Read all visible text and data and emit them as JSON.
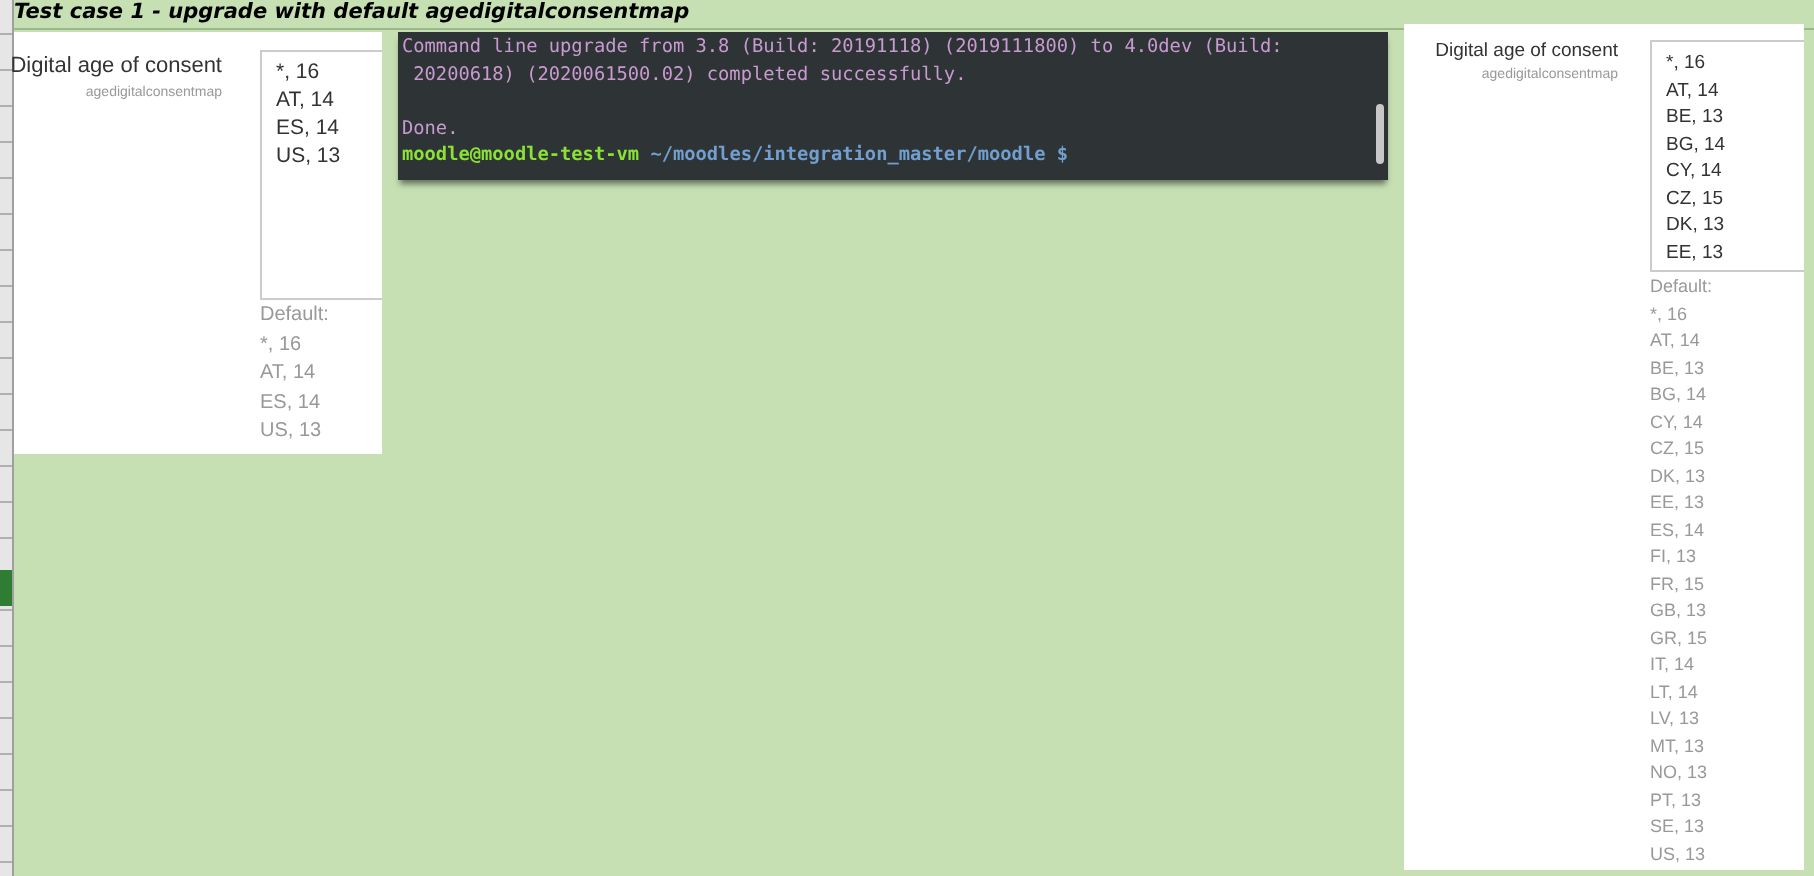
{
  "heading": "Test case 1 - upgrade with default agedigitalconsentmap",
  "left_panel": {
    "label": "Digital age of consent",
    "setting_name": "agedigitalconsentmap",
    "list_items": [
      "*, 16",
      "AT, 14",
      "ES, 14",
      "US, 13"
    ],
    "default_label": "Default:",
    "default_items": [
      "*, 16",
      "AT, 14",
      "ES, 14",
      "US, 13"
    ]
  },
  "terminal": {
    "output_blocks": [
      [
        "Command line upgrade from 3.8 (Build: 20191118) (2019111800) to 4.0dev (Build:",
        " 20200618) (2020061500.02) completed successfully."
      ],
      [
        "Done."
      ]
    ],
    "prompt": {
      "user_host": "moodle@moodle-test-vm",
      "path": "~/moodles/integration_master/moodle $"
    }
  },
  "right_panel": {
    "label": "Digital age of consent",
    "setting_name": "agedigitalconsentmap",
    "list_items": [
      "*, 16",
      "AT, 14",
      "BE, 13",
      "BG, 14",
      "CY, 14",
      "CZ, 15",
      "DK, 13",
      "EE, 13"
    ],
    "default_label": "Default:",
    "default_items": [
      "*, 16",
      "AT, 14",
      "BE, 13",
      "BG, 14",
      "CY, 14",
      "CZ, 15",
      "DK, 13",
      "EE, 13",
      "ES, 14",
      "FI, 13",
      "FR, 15",
      "GB, 13",
      "GR, 15",
      "IT, 14",
      "LT, 14",
      "LV, 13",
      "MT, 13",
      "NO, 13",
      "PT, 13",
      "SE, 13",
      "US, 13"
    ]
  }
}
